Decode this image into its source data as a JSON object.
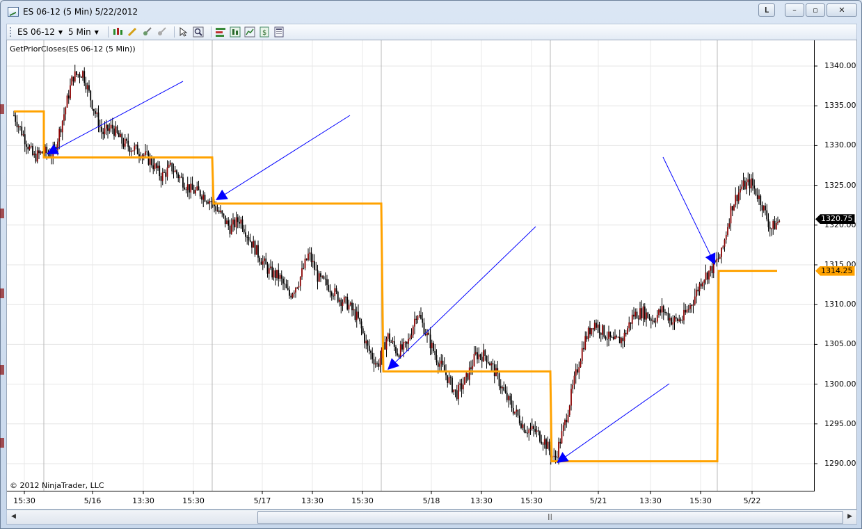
{
  "window": {
    "title": "ES 06-12 (5 Min)  5/22/2012",
    "buttons": {
      "l": "L",
      "minimize": "–",
      "maximize": "▫",
      "close": "✕"
    }
  },
  "toolbar": {
    "instrument": "ES 06-12",
    "interval": "5 Min",
    "icons": [
      "bar-type-icon",
      "pencil-icon",
      "magnet-icon",
      "crosshair-icon",
      "pointer-icon",
      "zoom-icon",
      "indicators-icon",
      "strategies-icon",
      "chart-style-icon",
      "data-box-icon",
      "properties-icon"
    ]
  },
  "chart": {
    "indicator_label": "GetPriorCloses(ES 06-12 (5 Min))",
    "copyright": "© 2012 NinjaTrader, LLC",
    "price_badge": "1320.75",
    "prior_close_badge": "1314.25",
    "colors": {
      "prior_close_line": "#ffa200",
      "arrows": "#0000ff",
      "candle_up": "#8b0000",
      "candle_down": "#000000"
    }
  },
  "chart_data": {
    "type": "line",
    "series": [
      {
        "values": [
          1333.8,
          1331.2,
          1328.5,
          1329.2,
          1328.8,
          1333.5,
          1338.7,
          1339.2,
          1335.1,
          1331.5,
          1332.3,
          1330.4,
          1329.7,
          1329.1,
          1327.9,
          1326.1,
          1327.3,
          1325.8,
          1324.4,
          1324.0,
          1323.1,
          1321.4,
          1319.6,
          1320.8,
          1318.2,
          1316.0,
          1314.1,
          1313.5,
          1311.1,
          1313.0,
          1316.4,
          1313.2,
          1312.4,
          1310.9,
          1310.0,
          1308.2,
          1304.5,
          1302.3,
          1306.1,
          1304.0,
          1304.8,
          1309.2,
          1306.2,
          1303.3,
          1301.1,
          1298.7,
          1300.6,
          1303.7,
          1303.6,
          1301.4,
          1298.5,
          1296.5,
          1294.4,
          1294.1,
          1292.8,
          1290.4,
          1294.8,
          1300.3,
          1305.3,
          1307.8,
          1306.5,
          1305.2,
          1305.8,
          1308.7,
          1309.1,
          1308.1,
          1309.4,
          1307.9,
          1308.2,
          1310.3,
          1313.2,
          1314.5,
          1316.4,
          1322.3,
          1324.8,
          1325.3,
          1323.0,
          1319.5,
          1320.75
        ]
      },
      {
        "values": [
          1334.3,
          1334.3,
          1328.5,
          1328.5,
          1322.7,
          1322.7,
          1301.6,
          1301.6,
          1290.3,
          1290.3,
          1314.25,
          1314.25
        ]
      }
    ],
    "y_ticks": [
      "1340.00",
      "1335.00",
      "1330.00",
      "1325.00",
      "1320.00",
      "1315.00",
      "1310.00",
      "1305.00",
      "1300.00",
      "1295.00",
      "1290.00"
    ],
    "x_ticks": [
      "15:30",
      "5/16",
      "13:30",
      "15:30",
      "5/17",
      "13:30",
      "15:30",
      "5/18",
      "13:30",
      "15:30",
      "5/21",
      "13:30",
      "15:30",
      "5/22"
    ],
    "ylim": [
      1287.5,
      1342.5
    ],
    "grid": true
  }
}
